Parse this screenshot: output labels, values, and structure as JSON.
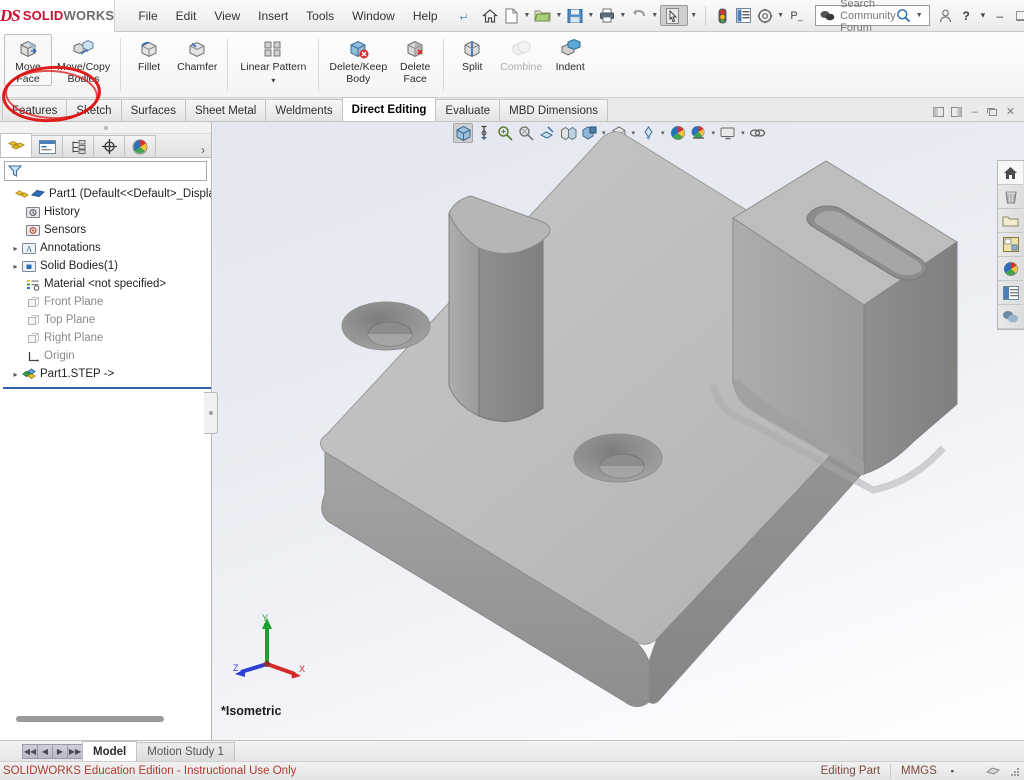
{
  "app": {
    "brand_ds": "DS",
    "brand_solid": "SOLID",
    "brand_works": "WORKS",
    "accent_red": "#c8102e",
    "annotation_color": "#e01b1b"
  },
  "menubar": {
    "items": [
      {
        "label": "File",
        "name": "menu-file"
      },
      {
        "label": "Edit",
        "name": "menu-edit"
      },
      {
        "label": "View",
        "name": "menu-view"
      },
      {
        "label": "Insert",
        "name": "menu-insert"
      },
      {
        "label": "Tools",
        "name": "menu-tools"
      },
      {
        "label": "Window",
        "name": "menu-window"
      },
      {
        "label": "Help",
        "name": "menu-help"
      }
    ],
    "pin_icon": "pushpin-icon",
    "quick_access": [
      {
        "icon": "home-icon"
      },
      {
        "icon": "new-document-icon"
      },
      {
        "icon": "open-folder-icon"
      },
      {
        "icon": "save-icon"
      },
      {
        "icon": "print-icon"
      },
      {
        "icon": "undo-icon"
      },
      {
        "icon": "select-cursor-icon"
      },
      {
        "icon": "rebuild-traffic-icon"
      },
      {
        "icon": "file-properties-icon"
      },
      {
        "icon": "options-gear-icon"
      },
      {
        "icon": "p-label-icon",
        "label": "P_"
      }
    ],
    "search": {
      "placeholder": "Search Community Forum",
      "icon": "comment-bubbles-icon",
      "magnifier": "magnifier-icon",
      "dropdown": "chevron-down-icon"
    },
    "user_icon": "user-account-icon",
    "help_label": "?",
    "window_controls": {
      "minimize": "–",
      "maximize": "❑",
      "close": "✕"
    }
  },
  "ribbon": {
    "commands": [
      {
        "label": "Move\nFace",
        "name": "move-face",
        "icon": "move-face-icon",
        "disabled": false,
        "selected": true,
        "highlighted": true
      },
      {
        "label": "Move/Copy\nBodies",
        "name": "move-copy-bodies",
        "icon": "move-copy-bodies-icon",
        "disabled": false
      },
      {
        "label": "Fillet",
        "name": "fillet",
        "icon": "fillet-icon",
        "disabled": false
      },
      {
        "label": "Chamfer",
        "name": "chamfer",
        "icon": "chamfer-icon",
        "disabled": false
      },
      {
        "label": "Linear Pattern",
        "name": "linear-pattern",
        "icon": "linear-pattern-icon",
        "disabled": false,
        "has_dropdown": true
      },
      {
        "label": "Delete/Keep\nBody",
        "name": "delete-keep-body",
        "icon": "delete-keep-body-icon",
        "disabled": false
      },
      {
        "label": "Delete\nFace",
        "name": "delete-face",
        "icon": "delete-face-icon",
        "disabled": false
      },
      {
        "label": "Split",
        "name": "split",
        "icon": "split-icon",
        "disabled": false
      },
      {
        "label": "Combine",
        "name": "combine",
        "icon": "combine-icon",
        "disabled": true
      },
      {
        "label": "Indent",
        "name": "indent",
        "icon": "indent-icon",
        "disabled": false
      }
    ]
  },
  "tabs": {
    "items": [
      {
        "label": "Features",
        "name": "tab-features",
        "active": false
      },
      {
        "label": "Sketch",
        "name": "tab-sketch",
        "active": false
      },
      {
        "label": "Surfaces",
        "name": "tab-surfaces",
        "active": false
      },
      {
        "label": "Sheet Metal",
        "name": "tab-sheet-metal",
        "active": false
      },
      {
        "label": "Weldments",
        "name": "tab-weldments",
        "active": false
      },
      {
        "label": "Direct Editing",
        "name": "tab-direct-editing",
        "active": true
      },
      {
        "label": "Evaluate",
        "name": "tab-evaluate",
        "active": false
      },
      {
        "label": "MBD Dimensions",
        "name": "tab-mbd-dimensions",
        "active": false
      }
    ],
    "doc_controls": [
      "restore-left-icon",
      "restore-right-icon",
      "minimize-icon",
      "restore-icon",
      "close-icon"
    ]
  },
  "feature_tree": {
    "panel_tabs": [
      {
        "name": "feature-manager-tab",
        "icon": "feature-tree-icon",
        "active": true
      },
      {
        "name": "property-manager-tab",
        "icon": "property-manager-icon",
        "active": false
      },
      {
        "name": "configuration-manager-tab",
        "icon": "configuration-manager-icon",
        "active": false
      },
      {
        "name": "dimxpert-manager-tab",
        "icon": "dimxpert-icon",
        "active": false
      },
      {
        "name": "display-manager-tab",
        "icon": "display-manager-icon",
        "active": false
      }
    ],
    "more_chevron": "›",
    "filter_icon": "filter-funnel-icon",
    "filter_value": "",
    "nodes": [
      {
        "label": "Part1  (Default<<Default>_Displa",
        "name": "tree-item-part1",
        "icon": "part-icon",
        "indent": 0,
        "expandable": false,
        "gray": false,
        "root": true
      },
      {
        "label": "History",
        "name": "tree-item-history",
        "icon": "history-icon",
        "indent": 1,
        "expandable": false,
        "gray": false
      },
      {
        "label": "Sensors",
        "name": "tree-item-sensors",
        "icon": "sensors-icon",
        "indent": 1,
        "expandable": false,
        "gray": false
      },
      {
        "label": "Annotations",
        "name": "tree-item-annotations",
        "icon": "annotations-icon",
        "indent": 1,
        "expandable": true,
        "gray": false
      },
      {
        "label": "Solid Bodies(1)",
        "name": "tree-item-solid-bodies",
        "icon": "solid-bodies-icon",
        "indent": 1,
        "expandable": true,
        "gray": false
      },
      {
        "label": "Material <not specified>",
        "name": "tree-item-material",
        "icon": "material-icon",
        "indent": 1,
        "expandable": false,
        "gray": false
      },
      {
        "label": "Front Plane",
        "name": "tree-item-front-plane",
        "icon": "plane-icon",
        "indent": 1,
        "expandable": false,
        "gray": true
      },
      {
        "label": "Top Plane",
        "name": "tree-item-top-plane",
        "icon": "plane-icon",
        "indent": 1,
        "expandable": false,
        "gray": true
      },
      {
        "label": "Right Plane",
        "name": "tree-item-right-plane",
        "icon": "plane-icon",
        "indent": 1,
        "expandable": false,
        "gray": true
      },
      {
        "label": "Origin",
        "name": "tree-item-origin",
        "icon": "origin-icon",
        "indent": 1,
        "expandable": false,
        "gray": true
      },
      {
        "label": "Part1.STEP ->",
        "name": "tree-item-part1-step",
        "icon": "imported-body-icon",
        "indent": 1,
        "expandable": true,
        "gray": false
      }
    ]
  },
  "graphics": {
    "view_toolbar": [
      {
        "name": "view-orientation-button",
        "icon": "view-orientation-icon",
        "selected": true
      },
      {
        "name": "zoom-to-fit-button",
        "icon": "zoom-to-fit-icon"
      },
      {
        "name": "zoom-to-area-button",
        "icon": "zoom-to-area-icon"
      },
      {
        "name": "previous-view-button",
        "icon": "previous-view-icon"
      },
      {
        "name": "section-view-button",
        "icon": "section-view-icon"
      },
      {
        "name": "view-orientation-cube-button",
        "icon": "view-cube-icon"
      },
      {
        "name": "display-style-button",
        "icon": "display-style-icon",
        "has_dropdown": true
      },
      {
        "name": "hide-show-items-button",
        "icon": "hide-show-icon",
        "has_dropdown": true
      },
      {
        "name": "edit-appearance-button",
        "icon": "appearance-icon",
        "has_dropdown": true
      },
      {
        "name": "apply-scene-button",
        "icon": "scene-icon",
        "has_dropdown": true
      },
      {
        "name": "view-settings-button",
        "icon": "view-settings-icon",
        "has_dropdown": true
      },
      {
        "name": "hide-all-types-button",
        "icon": "hide-all-types-icon"
      }
    ],
    "task_panel": [
      {
        "name": "task-home-button",
        "icon": "home-icon"
      },
      {
        "name": "task-design-library-button",
        "icon": "design-library-icon"
      },
      {
        "name": "task-file-explorer-button",
        "icon": "file-explorer-icon"
      },
      {
        "name": "task-view-palette-button",
        "icon": "view-palette-icon"
      },
      {
        "name": "task-appearances-button",
        "icon": "appearances-scenes-icon"
      },
      {
        "name": "task-custom-properties-button",
        "icon": "custom-properties-icon"
      },
      {
        "name": "task-forum-button",
        "icon": "forum-icon"
      }
    ],
    "view_label": "*Isometric",
    "triad": {
      "x_label": "X",
      "y_label": "Y",
      "z_label": "Z",
      "x_color": "#d42a2a",
      "y_color": "#1f9d2f",
      "z_color": "#2c3fd4"
    },
    "model": {
      "name": "base-plate-with-boss",
      "body_color": "#b4b4b4",
      "description": "Square base plate with four countersunk corner holes and a central rectangular boss with a slot"
    }
  },
  "bottom": {
    "nav_buttons": [
      "⏪",
      "◀",
      "▶",
      "⏩"
    ],
    "tabs": [
      {
        "label": "Model",
        "name": "bottom-tab-model",
        "active": true
      },
      {
        "label": "Motion Study 1",
        "name": "bottom-tab-motion-study-1",
        "active": false
      }
    ]
  },
  "statusbar": {
    "education_notice": "SOLIDWORKS Education Edition - Instructional Use Only",
    "edit_mode": "Editing Part",
    "units": "MMGS",
    "units_caret": "▪",
    "overlay_icon": "overlay-icon",
    "resize_grip": "resize-grip-icon"
  }
}
